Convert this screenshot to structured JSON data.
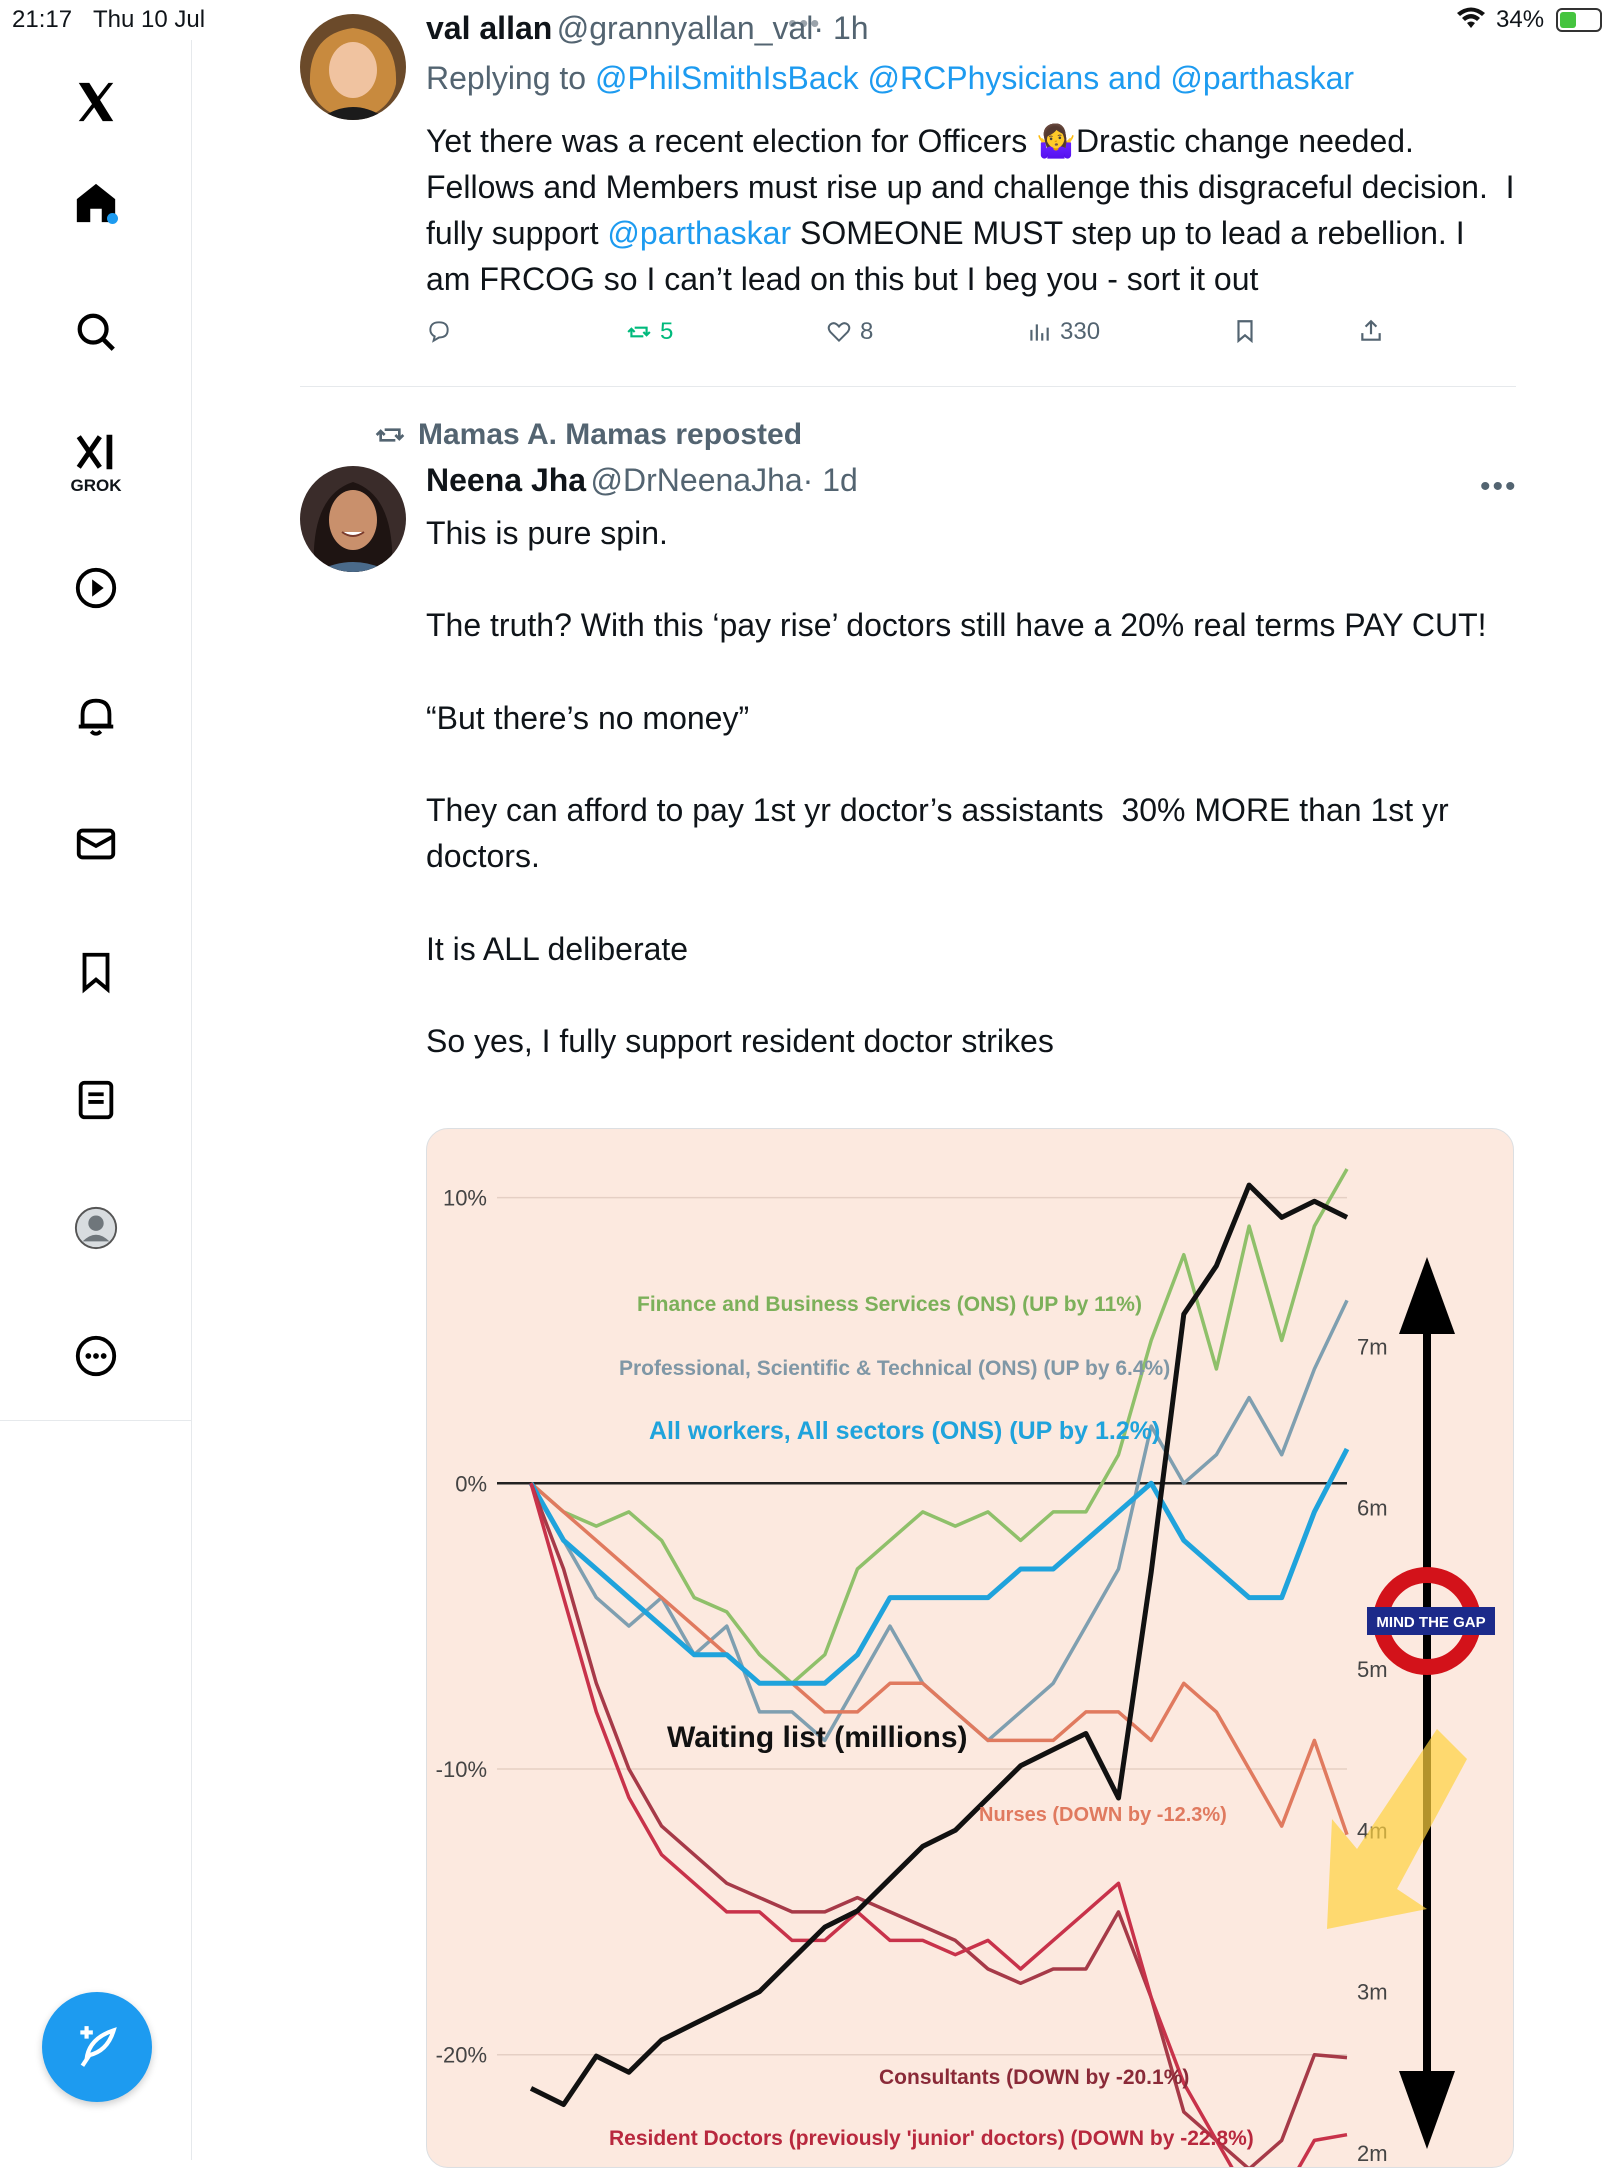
{
  "status_bar": {
    "time": "21:17",
    "date": "Thu 10 Jul",
    "battery": "34%"
  },
  "sidebar": {
    "grok_label": "GROK"
  },
  "tweet1": {
    "name": "val allan",
    "handle": "@grannyallan_val",
    "time": "· 1h",
    "replying_prefix": "Replying to",
    "replying_to": "@PhilSmithIsBack @RCPhysicians and @parthaskar",
    "text_before_link": "Yet there was a recent election for Officers 🤷‍♀️Drastic change needed. Fellows and Members must rise up and challenge this disgraceful decision.  I fully support ",
    "text_link": "@parthaskar",
    "text_after_link": " SOMEONE MUST step up to lead a rebellion. I am FRCOG so I can’t lead on this but I beg you - sort it out",
    "stats": {
      "replies": "",
      "reposts": "5",
      "likes": "8",
      "views": "330"
    }
  },
  "tweet2": {
    "reposted_by": "Mamas A. Mamas reposted",
    "name": "Neena Jha",
    "handle": "@DrNeenaJha",
    "time": "· 1d",
    "text": "This is pure spin.\n\nThe truth? With this ‘pay rise’ doctors still have a 20% real terms PAY CUT!\n\n“But there’s no money”\n\nThey can afford to pay 1st yr doctor’s assistants  30% MORE than 1st yr doctors.\n\nIt is ALL deliberate\n\nSo yes, I fully support resident doctor strikes"
  },
  "chart_data": {
    "type": "line",
    "title": "",
    "left_axis_ticks": [
      "10%",
      "0%",
      "-10%",
      "-20%"
    ],
    "right_axis_ticks": [
      "7m",
      "6m",
      "5m",
      "4m",
      "3m",
      "2m"
    ],
    "ylim": [
      -24,
      11
    ],
    "y2lim": [
      1.9,
      8.1
    ],
    "series_labels": {
      "finance": "Finance and Business Services (ONS) (UP by 11%)",
      "professional": "Professional, Scientific & Technical (ONS) (UP by 6.4%)",
      "all_workers": "All workers, All sectors (ONS) (UP by 1.2%)",
      "waiting": "Waiting list (millions)",
      "nurses": "Nurses (DOWN by -12.3%)",
      "consultants": "Consultants (DOWN by -20.1%)",
      "resident": "Resident Doctors (previously 'junior' doctors) (DOWN by -22.8%)"
    },
    "badge": "MIND THE GAP",
    "colors": {
      "finance": "#8fc06a",
      "professional": "#7f9fb0",
      "all_workers": "#1fa3dc",
      "waiting": "#111111",
      "nurses": "#e07a5f",
      "consultants": "#a63a48",
      "resident": "#c8324a"
    },
    "series": [
      {
        "key": "finance",
        "x": [
          0,
          4,
          8,
          12,
          16,
          20,
          24,
          28,
          32,
          36,
          40,
          44,
          48,
          52,
          56,
          60,
          64,
          68,
          72,
          76,
          80,
          84,
          88,
          92,
          96,
          100
        ],
        "values": [
          0,
          -1,
          -1.5,
          -1,
          -2,
          -4,
          -4.5,
          -6,
          -7,
          -6,
          -3,
          -2,
          -1,
          -1.5,
          -1,
          -2,
          -1,
          -1,
          1,
          5,
          8,
          4,
          9,
          5,
          9,
          11
        ]
      },
      {
        "key": "professional",
        "x": [
          0,
          4,
          8,
          12,
          16,
          20,
          24,
          28,
          32,
          36,
          40,
          44,
          48,
          52,
          56,
          60,
          64,
          68,
          72,
          76,
          80,
          84,
          88,
          92,
          96,
          100
        ],
        "values": [
          0,
          -2,
          -4,
          -5,
          -4,
          -6,
          -5,
          -8,
          -8,
          -9,
          -7,
          -5,
          -7,
          -8,
          -9,
          -8,
          -7,
          -5,
          -3,
          2,
          0,
          1,
          3,
          1,
          4,
          6.4
        ]
      },
      {
        "key": "all_workers",
        "x": [
          0,
          4,
          8,
          12,
          16,
          20,
          24,
          28,
          32,
          36,
          40,
          44,
          48,
          52,
          56,
          60,
          64,
          68,
          72,
          76,
          80,
          84,
          88,
          92,
          96,
          100
        ],
        "values": [
          0,
          -2,
          -3,
          -4,
          -5,
          -6,
          -6,
          -7,
          -7,
          -7,
          -6,
          -4,
          -4,
          -4,
          -4,
          -3,
          -3,
          -2,
          -1,
          0,
          -2,
          -3,
          -4,
          -4,
          -1,
          1.2
        ]
      },
      {
        "key": "nurses",
        "x": [
          0,
          4,
          8,
          12,
          16,
          20,
          24,
          28,
          32,
          36,
          40,
          44,
          48,
          52,
          56,
          60,
          64,
          68,
          72,
          76,
          80,
          84,
          88,
          92,
          96,
          100
        ],
        "values": [
          0,
          -1,
          -2,
          -3,
          -4,
          -5,
          -6,
          -7,
          -7,
          -8,
          -8,
          -7,
          -7,
          -8,
          -9,
          -9,
          -9,
          -8,
          -8,
          -9,
          -7,
          -8,
          -10,
          -12,
          -9,
          -12.3
        ]
      },
      {
        "key": "consultants",
        "x": [
          0,
          4,
          8,
          12,
          16,
          20,
          24,
          28,
          32,
          36,
          40,
          44,
          48,
          52,
          56,
          60,
          64,
          68,
          72,
          76,
          80,
          84,
          88,
          92,
          96,
          100
        ],
        "values": [
          0,
          -3,
          -7,
          -10,
          -12,
          -13,
          -14,
          -14.5,
          -15,
          -15,
          -14.5,
          -15,
          -15.5,
          -16,
          -17,
          -17.5,
          -17,
          -17,
          -15,
          -18,
          -22,
          -23,
          -24,
          -23,
          -20,
          -20.1
        ]
      },
      {
        "key": "resident",
        "x": [
          0,
          4,
          8,
          12,
          16,
          20,
          24,
          28,
          32,
          36,
          40,
          44,
          48,
          52,
          56,
          60,
          64,
          68,
          72,
          76,
          80,
          84,
          88,
          92,
          96,
          100
        ],
        "values": [
          0,
          -4,
          -8,
          -11,
          -13,
          -14,
          -15,
          -15,
          -16,
          -16,
          -15,
          -16,
          -16,
          -16.5,
          -16,
          -17,
          -16,
          -15,
          -14,
          -18,
          -21,
          -23,
          -25,
          -25,
          -23,
          -22.8
        ]
      },
      {
        "key": "waiting",
        "axis": "right",
        "x": [
          0,
          4,
          8,
          12,
          16,
          20,
          24,
          28,
          32,
          36,
          40,
          44,
          48,
          52,
          56,
          60,
          64,
          68,
          72,
          76,
          80,
          84,
          88,
          92,
          96,
          100
        ],
        "values": [
          2.4,
          2.3,
          2.6,
          2.5,
          2.7,
          2.8,
          2.9,
          3.0,
          3.2,
          3.4,
          3.5,
          3.7,
          3.9,
          4.0,
          4.2,
          4.4,
          4.5,
          4.6,
          4.2,
          5.6,
          7.2,
          7.5,
          8.0,
          7.8,
          7.9,
          7.8
        ]
      }
    ]
  }
}
